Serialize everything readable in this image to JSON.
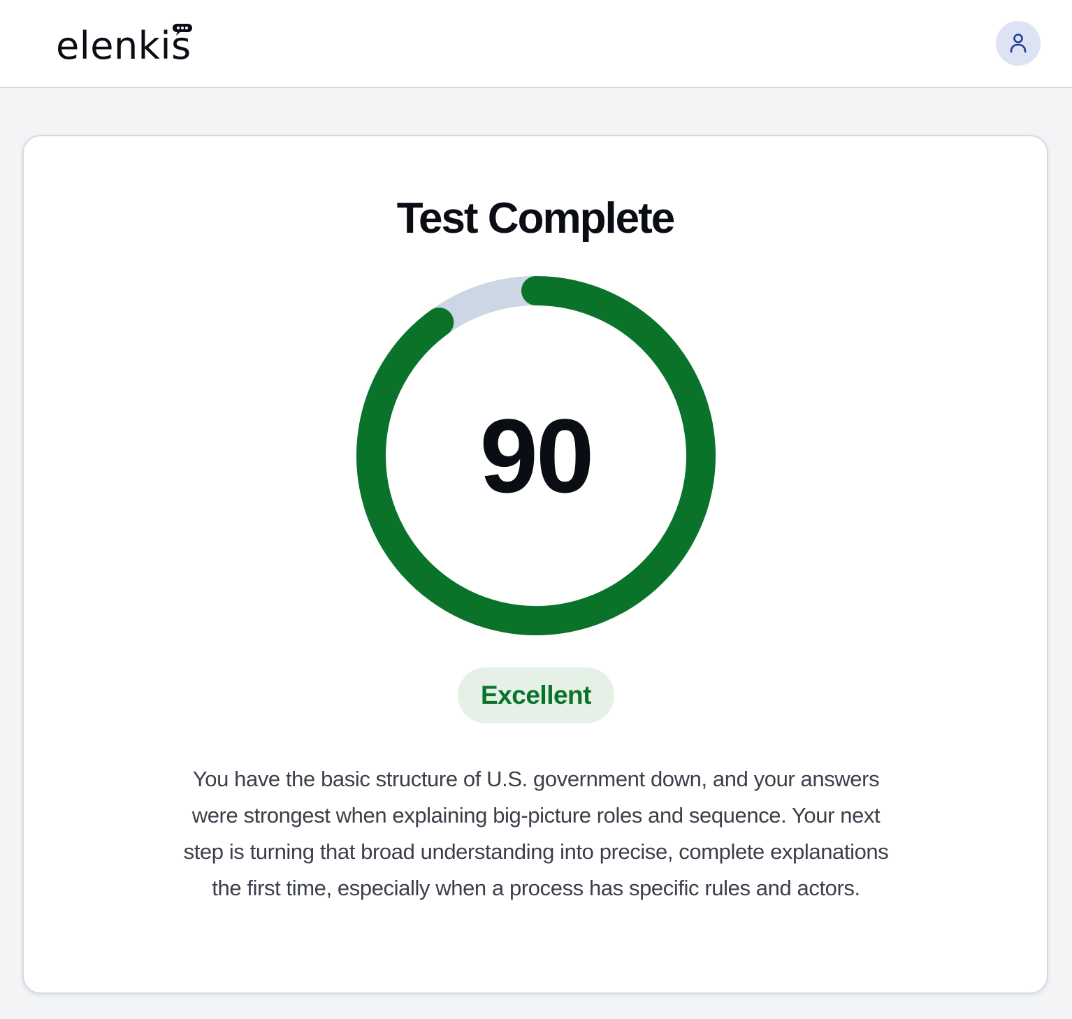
{
  "header": {
    "logo_text": "elenkis",
    "avatar_icon": "user-icon"
  },
  "result": {
    "title": "Test Complete",
    "score": "90",
    "score_max": 100,
    "rating": "Excellent",
    "summary": "You have the basic structure of U.S. government down, and your answers were strongest when explaining big-picture roles and sequence. Your next step is turning that broad understanding into precise, complete explanations the first time, especially when a process has specific rules and actors."
  },
  "colors": {
    "progress": "#0a7329",
    "track": "#ccd6e4",
    "badge_bg": "#e5f0e7",
    "badge_text": "#0a7329",
    "avatar_bg": "#dde3f3",
    "avatar_icon": "#1e3a9a"
  }
}
